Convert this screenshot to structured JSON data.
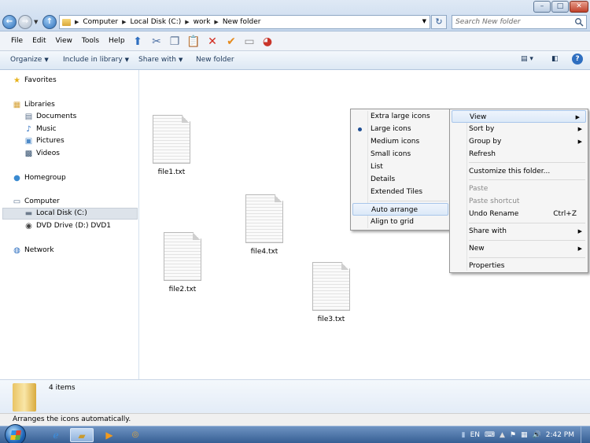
{
  "window": {
    "breadcrumb": [
      "Computer",
      "Local Disk (C:)",
      "work",
      "New folder"
    ],
    "search_placeholder": "Search New folder",
    "controls": {
      "minimize": "–",
      "maximize": "□",
      "close": "✕"
    }
  },
  "menubar": [
    "File",
    "Edit",
    "View",
    "Tools",
    "Help"
  ],
  "commandbar": {
    "organize": "Organize",
    "include": "Include in library",
    "share": "Share with",
    "new_folder": "New folder"
  },
  "nav": {
    "favorites": "Favorites",
    "libraries": "Libraries",
    "documents": "Documents",
    "music": "Music",
    "pictures": "Pictures",
    "videos": "Videos",
    "homegroup": "Homegroup",
    "computer": "Computer",
    "local_disk": "Local Disk (C:)",
    "dvd_drive": "DVD Drive (D:) DVD1",
    "network": "Network"
  },
  "files": [
    {
      "name": "file1.txt"
    },
    {
      "name": "file2.txt"
    },
    {
      "name": "file3.txt"
    },
    {
      "name": "file4.txt"
    }
  ],
  "context_main": {
    "view": "View",
    "sort_by": "Sort by",
    "group_by": "Group by",
    "refresh": "Refresh",
    "customize": "Customize this folder...",
    "paste": "Paste",
    "paste_shortcut": "Paste shortcut",
    "undo_rename": "Undo Rename",
    "undo_shortcut": "Ctrl+Z",
    "share_with": "Share with",
    "new": "New",
    "properties": "Properties"
  },
  "context_view": {
    "extra_large": "Extra large icons",
    "large": "Large icons",
    "medium": "Medium icons",
    "small": "Small icons",
    "list": "List",
    "details": "Details",
    "extended_tiles": "Extended Tiles",
    "auto_arrange": "Auto arrange",
    "align_grid": "Align to grid"
  },
  "details_pane": {
    "count": "4 items"
  },
  "statusbar": {
    "text": "Arranges the icons automatically."
  },
  "taskbar": {
    "lang": "EN",
    "time": "2:42 PM"
  }
}
